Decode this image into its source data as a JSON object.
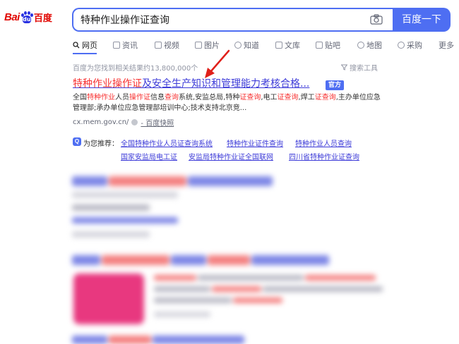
{
  "logo": {
    "left": "Bai",
    "paw": "du",
    "right": "百度"
  },
  "search": {
    "value": "特种作业操作证查询",
    "button": "百度一下"
  },
  "tabs": [
    {
      "label": "网页",
      "active": true
    },
    {
      "label": "资讯"
    },
    {
      "label": "视频"
    },
    {
      "label": "图片"
    },
    {
      "label": "知道"
    },
    {
      "label": "文库"
    },
    {
      "label": "贴吧"
    },
    {
      "label": "地图"
    },
    {
      "label": "采购"
    },
    {
      "label": "更多"
    }
  ],
  "results_count": "百度为您找到相关结果约13,800,000个",
  "search_tools": "搜索工具",
  "first_result": {
    "title_hl": "特种作业操作证",
    "title_rest": "及安全生产知识和管理能力考核合格...",
    "badge": "官方",
    "abstract": [
      {
        "t": "全国",
        "hl": false
      },
      {
        "t": "特种作业",
        "hl": true
      },
      {
        "t": "人员",
        "hl": false
      },
      {
        "t": "操作证",
        "hl": true
      },
      {
        "t": "信息",
        "hl": false
      },
      {
        "t": "查询",
        "hl": true
      },
      {
        "t": "系统,安监总局,特种",
        "hl": false
      },
      {
        "t": "证查询",
        "hl": true
      },
      {
        "t": ",电工",
        "hl": false
      },
      {
        "t": "证查询",
        "hl": true
      },
      {
        "t": ",焊工",
        "hl": false
      },
      {
        "t": "证查询",
        "hl": true
      },
      {
        "t": ",主办单位应急管理部;承办单位应急管理部培训中心;技术支持北京竞...",
        "hl": false
      }
    ],
    "url": "cx.mem.gov.cn/",
    "snapshot": "- 百度快照"
  },
  "recommend": {
    "label": "为您推荐：",
    "links": [
      "全国特种作业人员证查询系统",
      "特种作业证件查询",
      "特种作业人员查询",
      "国家安监局电工证",
      "安监局特种作业证全国联网",
      "四川省特种作业证查询"
    ]
  }
}
